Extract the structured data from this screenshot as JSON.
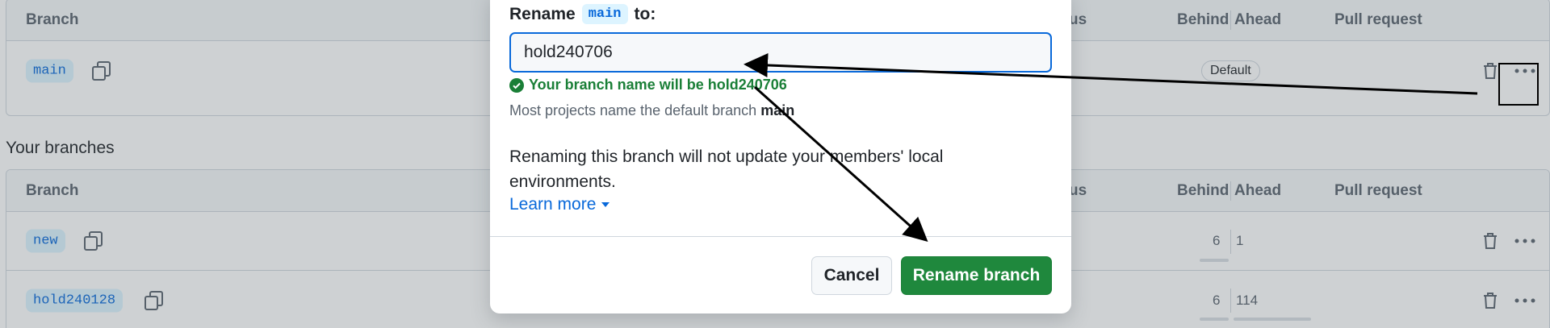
{
  "default_table": {
    "headers": {
      "branch": "Branch",
      "status_partial": "us",
      "behind": "Behind",
      "ahead": "Ahead",
      "pull_request": "Pull request"
    },
    "row": {
      "branch": "main",
      "badge": "Default"
    }
  },
  "your_branches": {
    "title": "Your branches",
    "headers": {
      "branch": "Branch",
      "status_partial": "us",
      "behind": "Behind",
      "ahead": "Ahead",
      "pull_request": "Pull request"
    },
    "rows": [
      {
        "branch": "new",
        "behind": "6",
        "ahead": "1"
      },
      {
        "branch": "hold240128",
        "behind": "6",
        "ahead": "114"
      }
    ]
  },
  "dialog": {
    "label_prefix": "Rename",
    "label_code": "main",
    "label_suffix": "to:",
    "input_value": "hold240706",
    "success_message": "Your branch name will be hold240706",
    "hint_prefix": "Most projects name the default branch",
    "hint_branch": "main",
    "warning": "Renaming this branch will not update your members' local environments.",
    "learn_more": "Learn more",
    "cancel_label": "Cancel",
    "rename_label": "Rename branch"
  },
  "colors": {
    "accent": "#0969da",
    "success": "#1a7f37",
    "primary_button": "#1f883d"
  }
}
